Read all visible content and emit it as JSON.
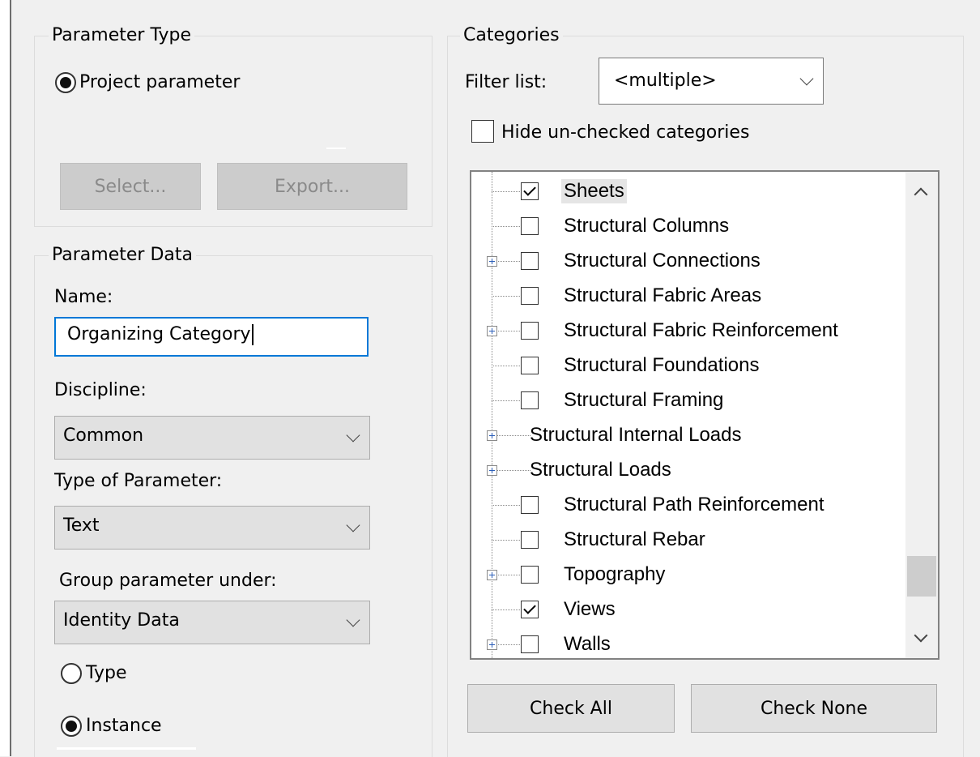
{
  "parameter_type": {
    "legend": "Parameter Type",
    "project_parameter_label": "Project parameter",
    "select_button": "Select...",
    "export_button": "Export..."
  },
  "parameter_data": {
    "legend": "Parameter Data",
    "name_label": "Name:",
    "name_value": "Organizing Category",
    "discipline_label": "Discipline:",
    "discipline_value": "Common",
    "type_label": "Type of Parameter:",
    "type_value": "Text",
    "group_label": "Group parameter under:",
    "group_value": "Identity Data",
    "type_radio_label": "Type",
    "instance_radio_label": "Instance"
  },
  "categories": {
    "legend": "Categories",
    "filter_label": "Filter list:",
    "filter_value": "<multiple>",
    "hide_unchecked_label": "Hide un-checked categories",
    "check_all_button": "Check All",
    "check_none_button": "Check None",
    "items": [
      {
        "label": "Sheets",
        "checked": true,
        "expandable": false,
        "has_checkbox": true,
        "selected": true
      },
      {
        "label": "Structural Columns",
        "checked": false,
        "expandable": false,
        "has_checkbox": true
      },
      {
        "label": "Structural Connections",
        "checked": false,
        "expandable": true,
        "has_checkbox": true
      },
      {
        "label": "Structural Fabric Areas",
        "checked": false,
        "expandable": false,
        "has_checkbox": true
      },
      {
        "label": "Structural Fabric Reinforcement",
        "checked": false,
        "expandable": true,
        "has_checkbox": true
      },
      {
        "label": "Structural Foundations",
        "checked": false,
        "expandable": false,
        "has_checkbox": true
      },
      {
        "label": "Structural Framing",
        "checked": false,
        "expandable": false,
        "has_checkbox": true
      },
      {
        "label": "Structural Internal Loads",
        "checked": false,
        "expandable": true,
        "has_checkbox": false
      },
      {
        "label": "Structural Loads",
        "checked": false,
        "expandable": true,
        "has_checkbox": false
      },
      {
        "label": "Structural Path Reinforcement",
        "checked": false,
        "expandable": false,
        "has_checkbox": true
      },
      {
        "label": "Structural Rebar",
        "checked": false,
        "expandable": false,
        "has_checkbox": true
      },
      {
        "label": "Topography",
        "checked": false,
        "expandable": true,
        "has_checkbox": true
      },
      {
        "label": "Views",
        "checked": true,
        "expandable": false,
        "has_checkbox": true
      },
      {
        "label": "Walls",
        "checked": false,
        "expandable": true,
        "has_checkbox": true
      }
    ]
  }
}
